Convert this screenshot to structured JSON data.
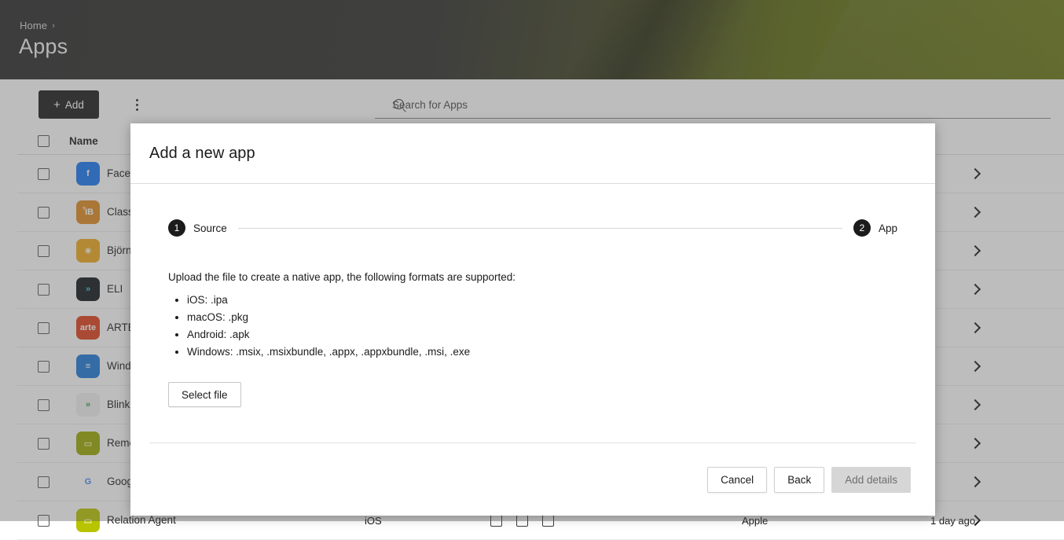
{
  "header": {
    "breadcrumb_home": "Home",
    "breadcrumb_separator": "›",
    "title": "Apps"
  },
  "toolbar": {
    "add_label": "Add",
    "add_plus": "+",
    "kebab_name": "more-options",
    "search_placeholder": "Search for Apps",
    "search_value": ""
  },
  "table": {
    "columns": [
      "Name"
    ],
    "header_name": "Name",
    "rows": [
      {
        "name": "Facebook",
        "icon_text": "f",
        "icon_bg": "#1877f2",
        "icon_fg": "#ffffff"
      },
      {
        "name": "Classroom Manager",
        "icon_text": "ἾB",
        "icon_bg": "#e08b1e",
        "icon_fg": "#ffffff"
      },
      {
        "name": "Björn",
        "icon_text": "☀",
        "icon_bg": "#f0a81c",
        "icon_fg": "#ffffff"
      },
      {
        "name": "ELI",
        "icon_text": "»",
        "icon_bg": "#10161c",
        "icon_fg": "#35c6d6"
      },
      {
        "name": "ARTE",
        "icon_text": "arte",
        "icon_bg": "#e0401c",
        "icon_fg": "#ffffff"
      },
      {
        "name": "Windows Notes",
        "icon_text": "≡",
        "icon_bg": "#1e78d7",
        "icon_fg": "#ffffff"
      },
      {
        "name": "Blink",
        "icon_text": "»",
        "icon_bg": "#f2f2f2",
        "icon_fg": "#2f9e41"
      },
      {
        "name": "Remote Folder",
        "icon_text": "▭",
        "icon_bg": "#9aa800",
        "icon_fg": "#e9f0a0"
      },
      {
        "name": "Google",
        "icon_text": "G",
        "icon_bg": "#ffffff",
        "icon_fg": "#4285f4"
      },
      {
        "name": "Relation Agent",
        "icon_text": "▭",
        "icon_bg": "#b8c400",
        "icon_fg": "#f3f7b0",
        "platform": "iOS",
        "vendor": "Apple",
        "updated": "1 day ago"
      }
    ],
    "chevron_name": "row-expand-chevron"
  },
  "modal": {
    "title": "Add a new app",
    "steps": [
      {
        "number": "1",
        "label": "Source"
      },
      {
        "number": "2",
        "label": "App"
      }
    ],
    "intro": "Upload the file to create a native app, the following formats are supported:",
    "formats": [
      "iOS: .ipa",
      "macOS: .pkg",
      "Android: .apk",
      "Windows: .msix, .msixbundle, .appx, .appxbundle, .msi, .exe"
    ],
    "select_file_label": "Select file",
    "buttons": {
      "cancel": "Cancel",
      "back": "Back",
      "add_details": "Add details"
    }
  },
  "colors": {
    "accent_dark": "#1b1b1b",
    "header_gradient_start": "#2b2b2b",
    "header_gradient_end": "#6e7d10",
    "disabled_button": "#d6d6d6"
  }
}
